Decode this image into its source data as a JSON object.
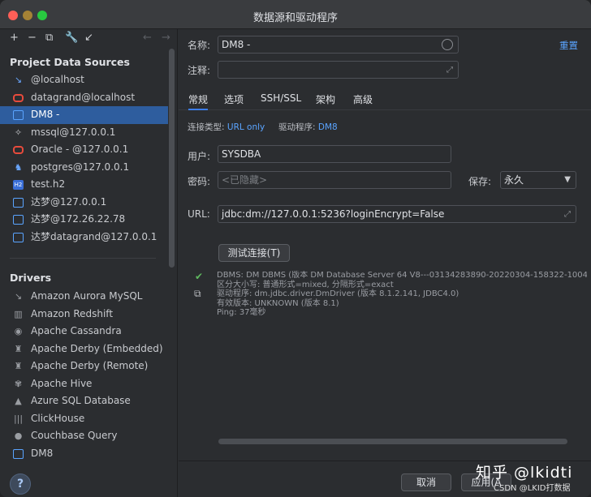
{
  "window": {
    "title": "数据源和驱动程序"
  },
  "toolbar": {
    "add": "+",
    "remove": "−",
    "copy": "⧉",
    "settings": "🔧",
    "import": "↙",
    "back": "←",
    "forward": "→"
  },
  "sidebar": {
    "project_title": "Project Data Sources",
    "data_sources": [
      {
        "label": "@localhost",
        "icon": "postgres-elephant-icon"
      },
      {
        "label": "datagrand@localhost",
        "icon": "oracle-icon"
      },
      {
        "label": "DM8 -",
        "icon": "dm-icon"
      },
      {
        "label": "mssql@127.0.0.1",
        "icon": "mssql-icon"
      },
      {
        "label": "Oracle - @127.0.0.1",
        "icon": "oracle-icon"
      },
      {
        "label": "postgres@127.0.0.1",
        "icon": "postgres-icon"
      },
      {
        "label": "test.h2",
        "icon": "h2-icon"
      },
      {
        "label": "达梦@127.0.0.1",
        "icon": "dm-icon"
      },
      {
        "label": "达梦@172.26.22.78",
        "icon": "dm-icon"
      },
      {
        "label": "达梦datagrand@127.0.0.1",
        "icon": "dm-icon"
      }
    ],
    "drivers_title": "Drivers",
    "drivers": [
      {
        "label": "Amazon Aurora MySQL",
        "icon": "aurora-icon"
      },
      {
        "label": "Amazon Redshift",
        "icon": "redshift-icon"
      },
      {
        "label": "Apache Cassandra",
        "icon": "cassandra-icon"
      },
      {
        "label": "Apache Derby (Embedded)",
        "icon": "derby-icon"
      },
      {
        "label": "Apache Derby (Remote)",
        "icon": "derby-icon"
      },
      {
        "label": "Apache Hive",
        "icon": "hive-icon"
      },
      {
        "label": "Azure SQL Database",
        "icon": "azure-icon"
      },
      {
        "label": "ClickHouse",
        "icon": "clickhouse-icon"
      },
      {
        "label": "Couchbase Query",
        "icon": "couchbase-icon"
      },
      {
        "label": "DM8",
        "icon": "dm-icon"
      }
    ],
    "help": "?"
  },
  "main": {
    "name_label": "名称:",
    "name_value": "DM8 -",
    "reset_label": "重置",
    "comment_label": "注释:",
    "comment_value": "",
    "tabs": [
      "常规",
      "选项",
      "SSH/SSL",
      "架构",
      "高级"
    ],
    "conn_type_label": "连接类型:",
    "conn_type_value": "URL only",
    "driver_label": "驱动程序:",
    "driver_value": "DM8",
    "user_label": "用户:",
    "user_value": "SYSDBA",
    "password_label": "密码:",
    "password_placeholder": "<已隐藏>",
    "save_label": "保存:",
    "save_value": "永久",
    "url_label": "URL:",
    "url_value": "jdbc:dm://127.0.0.1:5236?loginEncrypt=False",
    "test_button": "测试连接(T)",
    "result_lines": [
      "DBMS: DM DBMS (版本 DM Database Server 64 V8---03134283890-20220304-158322-1004",
      "区分大小写: 普通形式=mixed, 分隔形式=exact",
      "驱动程序: dm.jdbc.driver.DmDriver (版本 8.1.2.141, JDBC4.0)",
      "有效版本: UNKNOWN (版本 8.1)",
      "Ping: 37毫秒"
    ],
    "cancel_button": "取消",
    "apply_button": "应用(A"
  },
  "watermark": {
    "main": "知乎 @lkidti",
    "sub": "CSDN @LKID打数据"
  },
  "colors": {
    "accent": "#3d7eea",
    "selection": "#2e5d9e",
    "link": "#5aa4ff",
    "success": "#5fb85f"
  }
}
